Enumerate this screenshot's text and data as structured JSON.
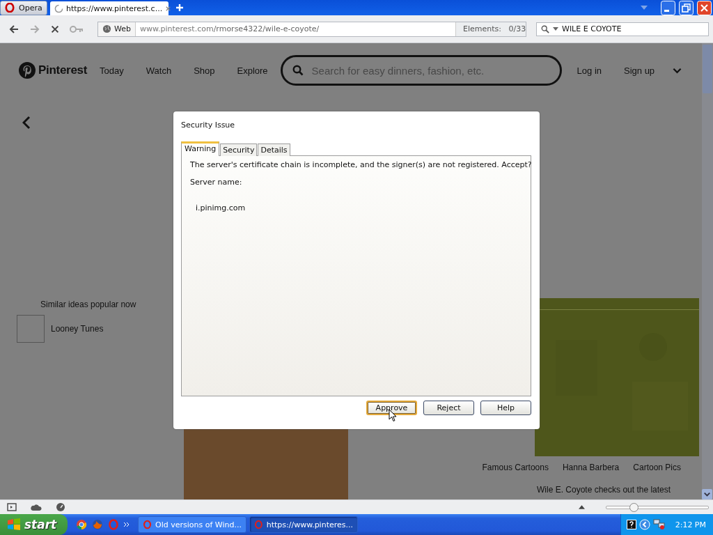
{
  "browser": {
    "menu_button": "Opera",
    "tabs": [
      {
        "title": "https://www.pinterest.c...",
        "selected": true,
        "loading": true
      }
    ]
  },
  "address_bar": {
    "scope": "Web",
    "url_host": "www.pinterest.com",
    "url_path": "/rmorse4322/wile-e-coyote/",
    "elements_label": "Elements:",
    "elements_count": "0/33",
    "search_value": "WILE E COYOTE"
  },
  "page": {
    "logo": "Pinterest",
    "nav": [
      "Today",
      "Watch",
      "Shop",
      "Explore"
    ],
    "search_placeholder": "Search for easy dinners, fashion, etc.",
    "login": "Log in",
    "signup": "Sign up",
    "similar_heading": "Similar ideas popular now",
    "similar_items": [
      {
        "label": "Looney Tunes"
      }
    ],
    "tags": [
      "Famous Cartoons",
      "Hanna Barbera",
      "Cartoon Pics"
    ],
    "caption": "Wile E. Coyote checks out the latest"
  },
  "dialog": {
    "title": "Security Issue",
    "tabs": [
      {
        "label": "Warning",
        "selected": true
      },
      {
        "label": "Security",
        "selected": false
      },
      {
        "label": "Details",
        "selected": false
      }
    ],
    "message": "The server's certificate chain is incomplete, and the signer(s) are not registered. Accept?",
    "field_label": "Server name:",
    "server": "i.pinimg.com",
    "buttons": [
      {
        "label": "Approve",
        "focused": true
      },
      {
        "label": "Reject",
        "focused": false
      },
      {
        "label": "Help",
        "focused": false
      }
    ]
  },
  "status_bar": {
    "zoom": {
      "level": 0.27
    }
  },
  "taskbar": {
    "start": "start",
    "tasks": [
      {
        "title": "Old versions of Wind...",
        "active": false
      },
      {
        "title": "https://www.pinteres...",
        "active": true
      }
    ],
    "clock": "2:12 PM"
  }
}
